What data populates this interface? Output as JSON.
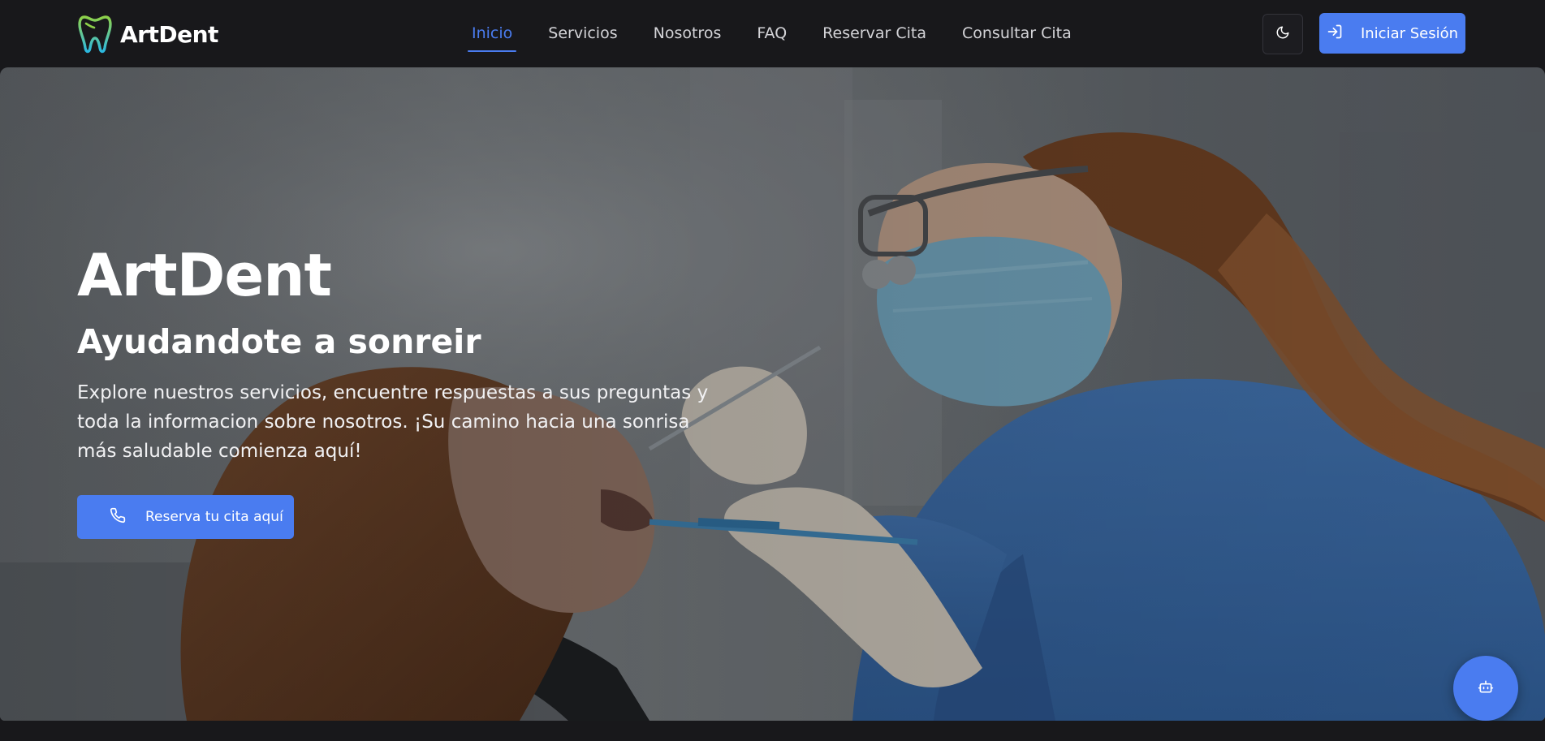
{
  "brand": {
    "name": "ArtDent",
    "colors": {
      "accent": "#4a7cf0",
      "background": "#18181b",
      "logo_green": "#8ed14a",
      "logo_cyan": "#2bb8e0"
    }
  },
  "nav": {
    "items": [
      {
        "label": "Inicio",
        "active": true
      },
      {
        "label": "Servicios"
      },
      {
        "label": "Nosotros"
      },
      {
        "label": "FAQ"
      },
      {
        "label": "Reservar Cita"
      },
      {
        "label": "Consultar Cita"
      }
    ]
  },
  "header": {
    "theme_toggle_icon": "moon-icon",
    "login": {
      "label": "Iniciar Sesión",
      "icon": "login-icon"
    }
  },
  "hero": {
    "title": "ArtDent",
    "subtitle": "Ayudandote a sonreir",
    "description": "Explore nuestros servicios, encuentre respuestas a sus preguntas y toda la informacion sobre nosotros. ¡Su camino hacia una sonrisa más saludable comienza aquí!",
    "cta": {
      "label": "Reserva tu cita aquí",
      "icon": "phone-icon"
    },
    "background_icon": "dentist-photo"
  },
  "chatbot": {
    "icon": "bot-icon"
  }
}
